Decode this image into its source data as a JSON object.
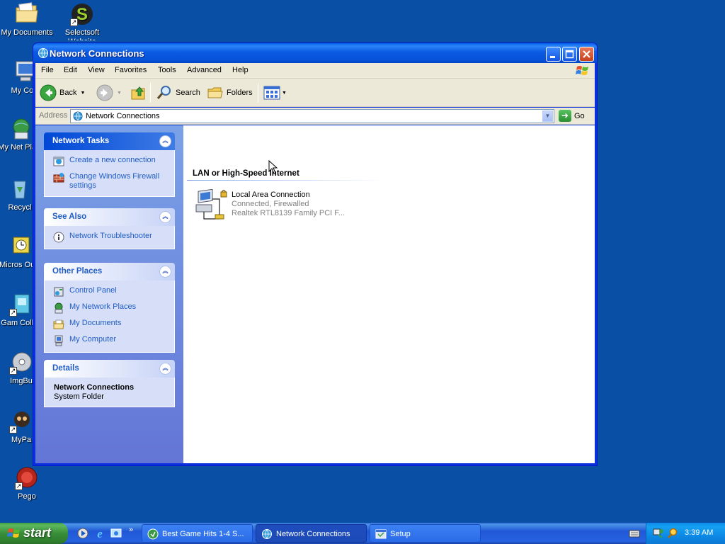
{
  "desktop": {
    "icons": [
      {
        "label": "My Documents"
      },
      {
        "label": "Selectsoft Website"
      },
      {
        "label": "My Com"
      },
      {
        "label": "My Net Place"
      },
      {
        "label": "Recycl"
      },
      {
        "label": "Micros Outlo"
      },
      {
        "label": "Gam Collec"
      },
      {
        "label": "ImgBu"
      },
      {
        "label": "MyPa"
      },
      {
        "label": "Pego"
      }
    ]
  },
  "window": {
    "title": "Network Connections",
    "menu": [
      "File",
      "Edit",
      "View",
      "Favorites",
      "Tools",
      "Advanced",
      "Help"
    ],
    "toolbar": {
      "back_label": "Back",
      "search_label": "Search",
      "folders_label": "Folders"
    },
    "address": {
      "label": "Address",
      "value": "Network Connections",
      "go_label": "Go"
    },
    "taskpane": {
      "network_tasks": {
        "title": "Network Tasks",
        "links": [
          "Create a new connection",
          "Change Windows Firewall settings"
        ]
      },
      "see_also": {
        "title": "See Also",
        "links": [
          "Network Troubleshooter"
        ]
      },
      "other_places": {
        "title": "Other Places",
        "links": [
          "Control Panel",
          "My Network Places",
          "My Documents",
          "My Computer"
        ]
      },
      "details": {
        "title": "Details",
        "name": "Network Connections",
        "type": "System Folder"
      }
    },
    "main": {
      "group_header": "LAN or High-Speed Internet",
      "connection": {
        "name": "Local Area Connection",
        "status": "Connected, Firewalled",
        "device": "Realtek RTL8139 Family PCI F..."
      }
    }
  },
  "taskbar": {
    "start_label": "start",
    "more_label": "»",
    "tasks": [
      {
        "label": "Best Game Hits 1-4 S..."
      },
      {
        "label": "Network Connections"
      },
      {
        "label": "Setup"
      }
    ],
    "clock": "3:39 AM"
  },
  "colors": {
    "desktop_bg": "#0a4fa6",
    "title_blue": "#0653d8",
    "link_blue": "#215dc6",
    "start_green": "#388e38"
  }
}
